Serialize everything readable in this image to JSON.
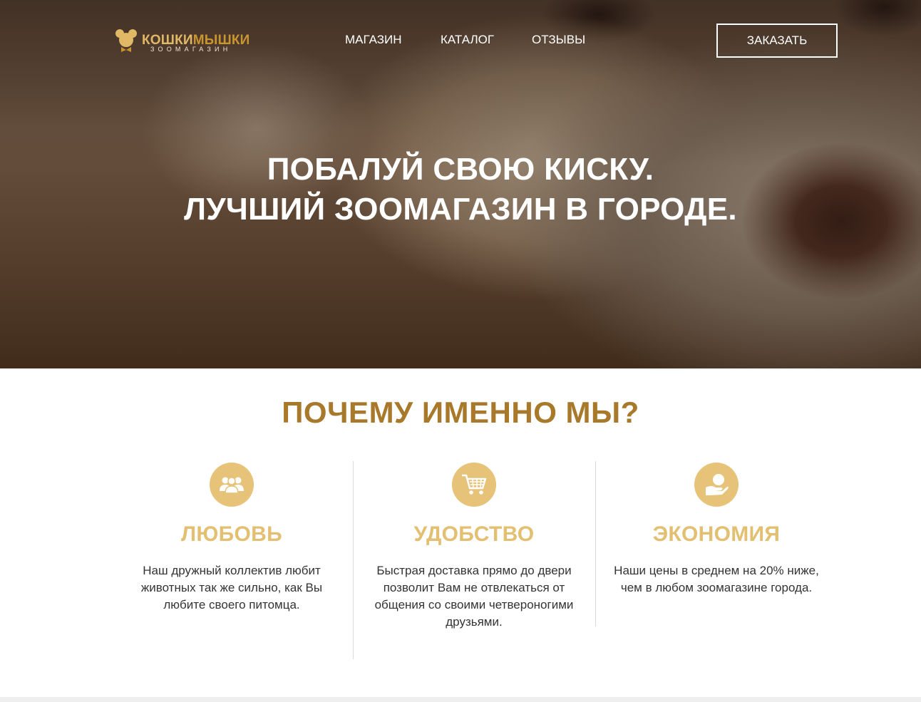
{
  "brand": {
    "name_part1": "КОШКИ",
    "name_part2": "МЫШКИ",
    "subtitle": "ЗООМАГАЗИН",
    "icon": "mouse-head-icon",
    "colors": {
      "light_gold": "#e0b866",
      "dark_gold": "#c9952f"
    }
  },
  "nav": {
    "items": [
      {
        "label": "МАГАЗИН"
      },
      {
        "label": "КАТАЛОГ"
      },
      {
        "label": "ОТЗЫВЫ"
      }
    ],
    "order_button": "ЗАКАЗАТЬ"
  },
  "hero": {
    "line1": "ПОБАЛУЙ СВОЮ КИСКУ.",
    "line2": "ЛУЧШИЙ ЗООМАГАЗИН В ГОРОДЕ."
  },
  "why": {
    "title": "ПОЧЕМУ ИМЕННО МЫ?",
    "title_color": "#a8792a",
    "features": [
      {
        "icon": "people-group-icon",
        "heading": "ЛЮБОВЬ",
        "text": "Наш дружный коллектив любит животных так же сильно, как Вы любите своего питомца."
      },
      {
        "icon": "shopping-cart-icon",
        "heading": "УДОБСТВО",
        "text": "Быстрая доставка прямо до двери позволит Вам не отвлекаться от общения со своими четвероногими друзьями."
      },
      {
        "icon": "hand-coin-icon",
        "heading": "ЭКОНОМИЯ",
        "text": "Наши цены в среднем на 20% ниже, чем в любом зоомагазине города."
      }
    ],
    "accent_color": "#e6c378"
  }
}
